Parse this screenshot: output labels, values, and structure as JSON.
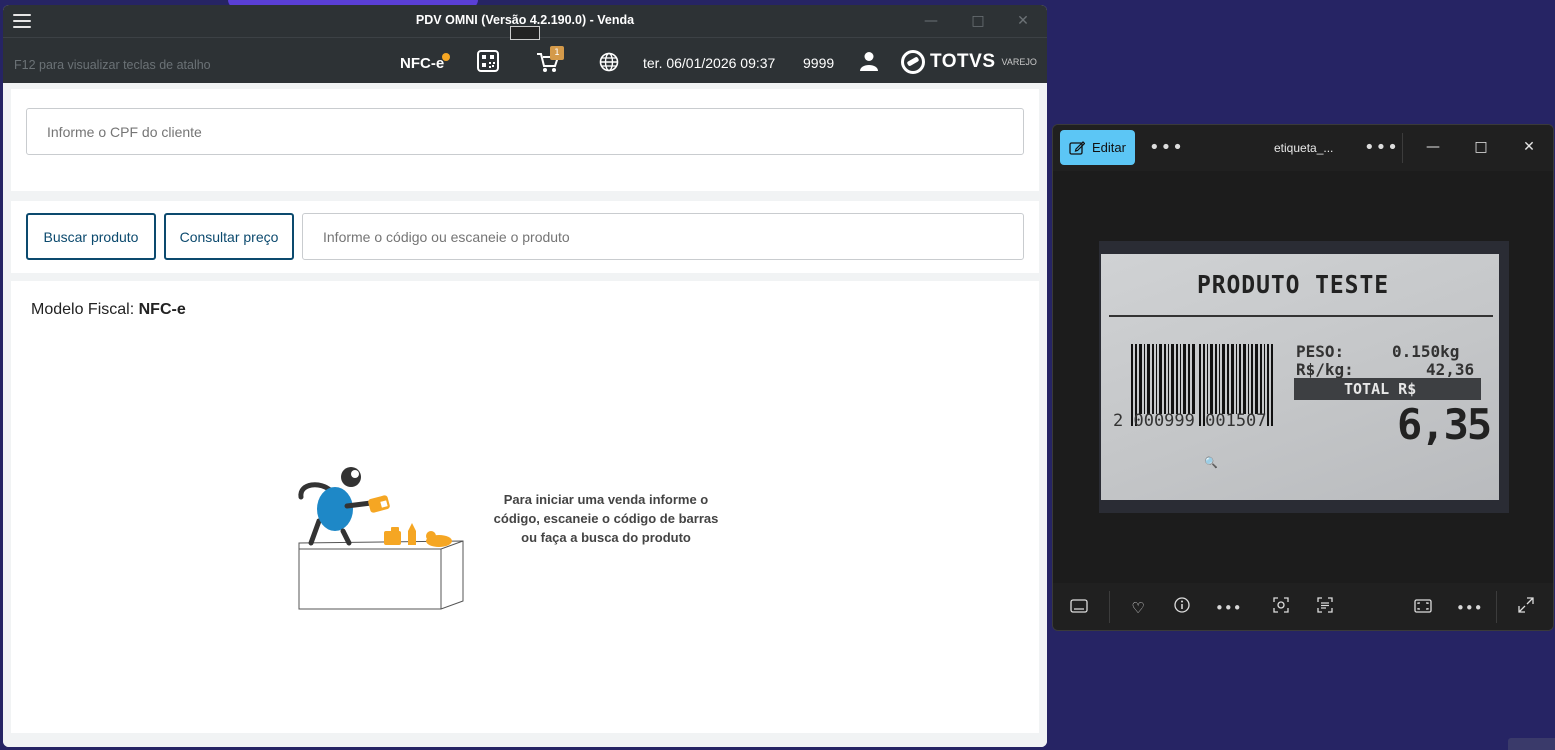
{
  "pdv": {
    "title": "PDV OMNI (Versão 4.2.190.0) - Venda",
    "hint": "F12 para visualizar teclas de atalho",
    "fiscal_model": "NFC-e",
    "cart_count": "1",
    "datetime": "ter. 06/01/2026 09:37",
    "store": "9999",
    "brand": "TOTVS",
    "brand_sub": "VAREJO",
    "cpf_placeholder": "Informe o CPF do cliente",
    "buscar_label": "Buscar produto",
    "consultar_label": "Consultar preço",
    "search_placeholder": "Informe o código ou escaneie o produto",
    "modelo_label": "Modelo Fiscal:",
    "modelo_value": "NFC-e",
    "empty_line1": "Para iniciar uma venda informe o",
    "empty_line2": "código, escaneie o código de barras",
    "empty_line3": "ou faça a busca do produto"
  },
  "photos": {
    "edit_label": "Editar",
    "filename": "etiqueta_...",
    "label": {
      "title": "PRODUTO TESTE",
      "barcode_number": "2 000999 001507",
      "peso_label": "PESO:",
      "peso_value": "0.150kg",
      "rskg_label": "R$/kg:",
      "rskg_value": "42,36",
      "total_label": "TOTAL  R$",
      "total_value": "6,35"
    }
  },
  "colors": {
    "desktop": "#262464",
    "titlebar": "#2d3235",
    "accent_blue": "#0c4a6e",
    "edit_button": "#5cc6f5",
    "badge": "#d49a4a",
    "illustration_blue": "#1e88c7",
    "illustration_orange": "#f5a623"
  }
}
